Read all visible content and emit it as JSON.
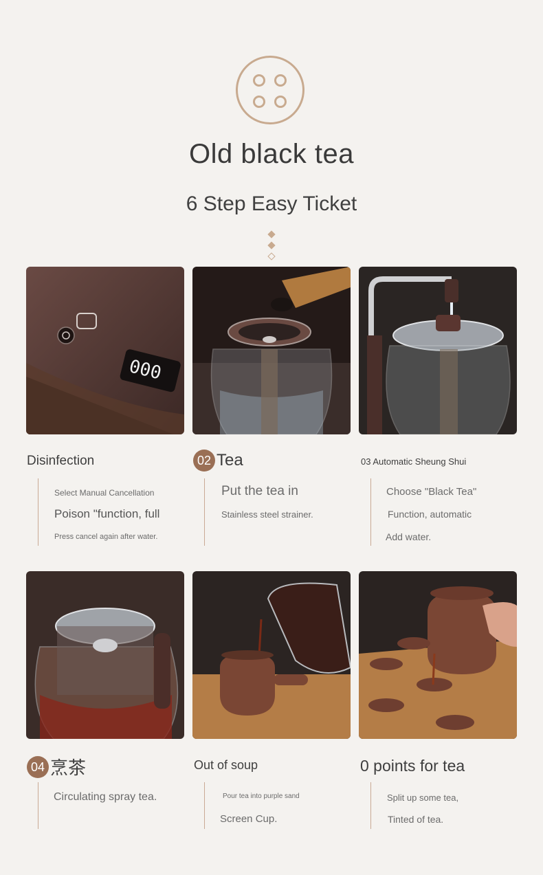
{
  "header": {
    "logo_icon": "four-circles-icon",
    "title": "Old black tea",
    "subtitle": "6 Step Easy Ticket"
  },
  "colors": {
    "accent": "#c8aa8f",
    "badge": "#9a6f55",
    "background": "#f4f2ef"
  },
  "steps": [
    {
      "heading": "Disinfection",
      "lines": [
        "Select Manual Cancellation",
        "Poison \"function, full",
        "Press cancel again after water."
      ],
      "image": "kettle-control-panel-photo"
    },
    {
      "badge": "02",
      "heading": "Tea",
      "lines": [
        "Put the tea in",
        "Stainless steel strainer."
      ],
      "image": "adding-tea-leaves-photo"
    },
    {
      "heading": "03 Automatic Sheung Shui",
      "lines": [
        "Choose \"Black Tea\"",
        "Function, automatic",
        "Add water."
      ],
      "image": "automatic-water-fill-photo"
    },
    {
      "badge": "04",
      "heading": "烹茶",
      "lines": [
        "Circulating spray tea."
      ],
      "image": "brewing-tea-photo"
    },
    {
      "heading": "Out of soup",
      "lines": [
        "Pour tea into purple sand",
        "Screen Cup."
      ],
      "image": "pouring-tea-photo"
    },
    {
      "heading": "0 points for tea",
      "lines": [
        "Split up some tea,",
        "Tinted of tea."
      ],
      "image": "serving-tea-cups-photo"
    }
  ]
}
